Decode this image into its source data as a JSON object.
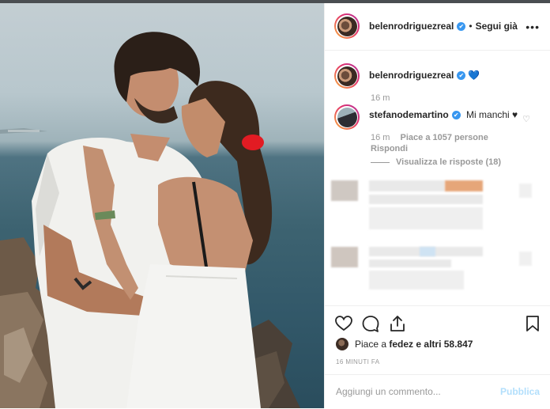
{
  "post": {
    "author": "belenrodriguezreal",
    "follow_separator": "•",
    "follow_label": "Segui già",
    "more_label": "•••"
  },
  "caption": {
    "author": "belenrodriguezreal",
    "text": "💙",
    "time": "16 m"
  },
  "comment": {
    "author": "stefanodemartino",
    "text": "Mi manchi ♥",
    "time": "16 m",
    "likes_text": "Piace a 1057 persone",
    "reply_label": "Rispondi",
    "view_replies": "Visualizza le risposte (18)"
  },
  "icons": {
    "verified": "✔",
    "comment_like": "♡"
  },
  "likes": {
    "prefix": "Piace a",
    "users": "fedez e altri 58.847"
  },
  "timestamp": "16 MINUTI FA",
  "composer": {
    "placeholder": "Aggiungi un commento...",
    "publish_label": "Pubblica"
  },
  "colors": {
    "verified_blue": "#3897f0",
    "publish_disabled": "#b2dffc",
    "muted_text": "#999999"
  }
}
